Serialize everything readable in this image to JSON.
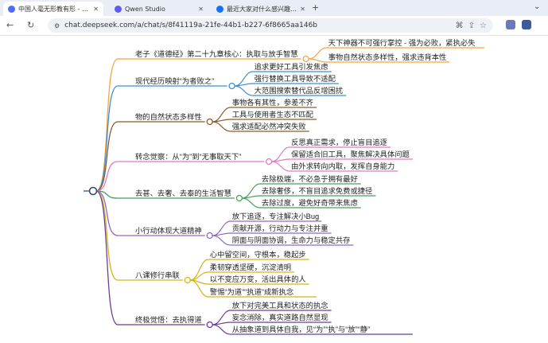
{
  "browser": {
    "tabs": [
      {
        "title": "中国人毫无形教有形 - DeepSe",
        "active": true,
        "favicon_color": "#4d6bfe"
      },
      {
        "title": "Qwen Studio",
        "active": false,
        "favicon_color": "#615ced"
      },
      {
        "title": "最近大家对什么感兴趣啊，出现",
        "active": false,
        "favicon_color": "#1772f6"
      }
    ],
    "new_tab": "+",
    "url": "chat.deepseek.com/a/chat/s/8f41119a-21fe-44b1-b227-6f8665aa146b"
  },
  "mindmap": {
    "branches": [
      {
        "label": "老子《道德经》第二十九章核心：执取与放手智慧",
        "color": "#f4a442",
        "children": [
          "天下神器不可强行掌控 - 强为必败，紧执必失",
          "事物自然状态多样性，强求违背本性"
        ]
      },
      {
        "label": "现代经历映射“为者败之”",
        "color": "#3b8fd4",
        "children": [
          "追求更好工具引发焦虑",
          "强行替换工具导致不适配",
          "大范围搜索替代品反增困扰"
        ]
      },
      {
        "label": "物的自然状态多样性",
        "color": "#8b5a2b",
        "children": [
          "事物各有其性，参差不齐",
          "工具与使用者生态不匹配",
          "强求适配必然冲突失败"
        ]
      },
      {
        "label": "转念觉察：从“为”到“无事取天下”",
        "color": "#e377c2",
        "children": [
          "反思真正需求，停止盲目追逐",
          "保留适合旧工具，聚焦解决具体问题",
          "由外求转向内取，发挥自身能力"
        ]
      },
      {
        "label": "去甚、去奢、去泰的生活智慧",
        "color": "#4a9e5c",
        "children": [
          "去除极端，不必急于拥有最好",
          "去除奢侈，不盲目追求免费或捷径",
          "去除过度，避免好奇带来焦虑"
        ]
      },
      {
        "label": "小行动体现大道精神",
        "color": "#8e6bbf",
        "children": [
          "放下追逐，专注解决小Bug",
          "贡献开源，行动力与专注并重",
          "阴面与阴面协调，生命力与稳定共存"
        ]
      },
      {
        "label": "八课修行串联",
        "color": "#d4b316",
        "children": [
          "心中留空间，守根本，稳起步",
          "柔韧穿透坚硬，沉淀清明",
          "以不变应万变，活出具体的人",
          "警惕“为道”“执道”成新执念"
        ]
      },
      {
        "label": "终极觉悟：去执得道",
        "color": "#6a3d9a",
        "children": [
          "放下对完美工具和状态的执念",
          "妄念消除，真实道路自然显现",
          "从抽象道到具体自我，见“为”“执”与“放”“静”"
        ]
      }
    ]
  }
}
